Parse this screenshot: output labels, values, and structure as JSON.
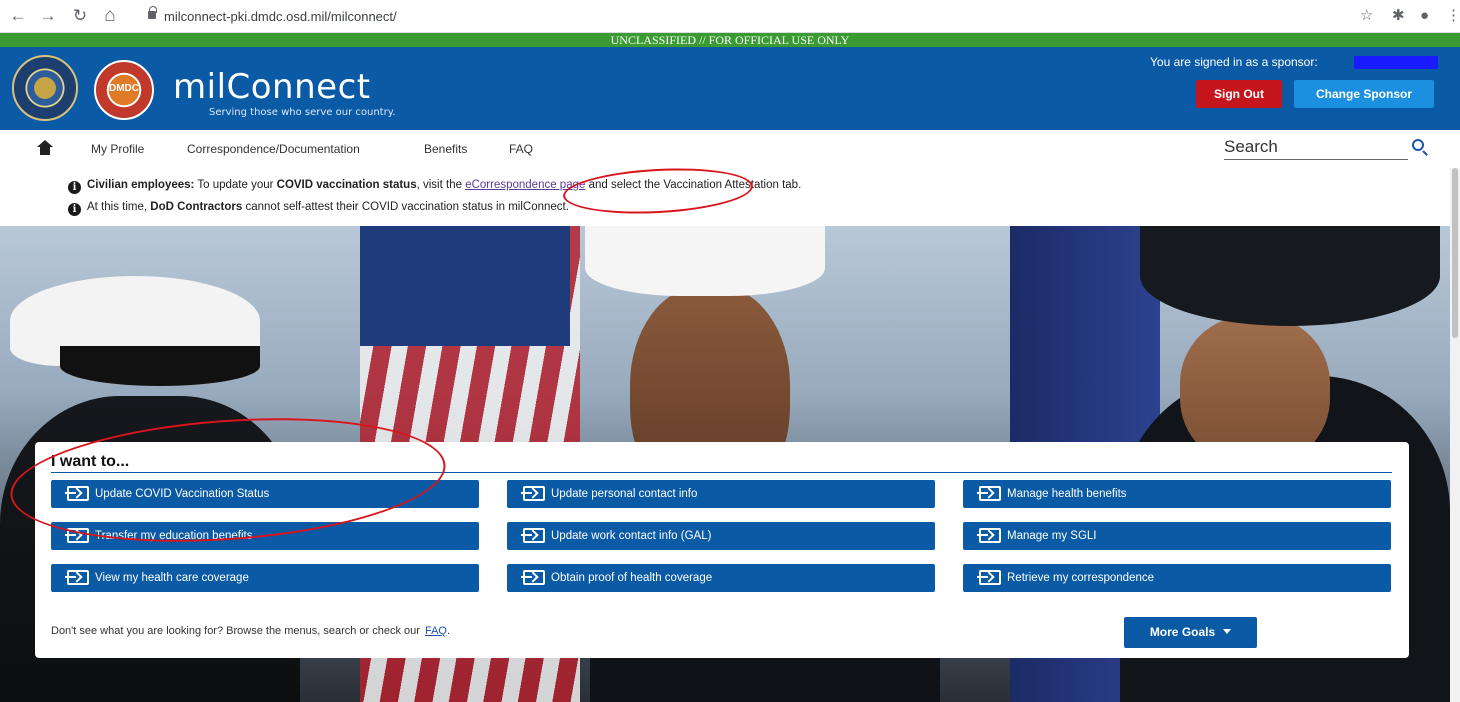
{
  "browser": {
    "back_glyph": "←",
    "forward_glyph": "→",
    "reload_glyph": "↻",
    "home_glyph": "⌂",
    "url": "milconnect-pki.dmdc.osd.mil/milconnect/",
    "bookmark_glyph": "☆",
    "extensions_glyph": "✱",
    "profile_glyph": "●",
    "menu_glyph": "⋮"
  },
  "classification": "UNCLASSIFIED // FOR OFFICIAL USE ONLY",
  "header": {
    "dmdc_label": "DMDC",
    "brand": "milConnect",
    "tagline": "Serving those who serve our country.",
    "signed_in_text": "You are signed in as a sponsor:",
    "sign_out_label": "Sign Out",
    "change_sponsor_label": "Change Sponsor"
  },
  "nav": {
    "items": [
      "My Profile",
      "Correspondence/Documentation",
      "Benefits",
      "FAQ"
    ],
    "search_placeholder": "Search"
  },
  "notices": {
    "n1": {
      "bold1": "Civilian employees:",
      "t1": " To update your ",
      "bold2": "COVID vaccination status",
      "t2": ", visit the ",
      "link": "eCorrespondence page",
      "t3": " and select the Vaccination Attestation tab."
    },
    "n2": {
      "t1": "At this time, ",
      "bold1": "DoD Contractors",
      "t2": " cannot self-attest their COVID vaccination status in milConnect."
    }
  },
  "panel": {
    "title": "I want to...",
    "goals": [
      "Update COVID Vaccination Status",
      "Update personal contact info",
      "Manage health benefits",
      "Transfer my education benefits",
      "Update work contact info (GAL)",
      "Manage my SGLI",
      "View my health care coverage",
      "Obtain proof of health coverage",
      "Retrieve my correspondence"
    ],
    "footer_text": "Don't see what you are looking for? Browse the menus, search or check our",
    "footer_link": "FAQ",
    "footer_end": ".",
    "more_goals_label": "More Goals"
  },
  "colors": {
    "header_blue": "#0b5aa5",
    "banner_green": "#3b9b33",
    "sign_out_red": "#c4161c",
    "change_sponsor_blue": "#1b8fe0",
    "annotation_red": "#d8141c"
  }
}
